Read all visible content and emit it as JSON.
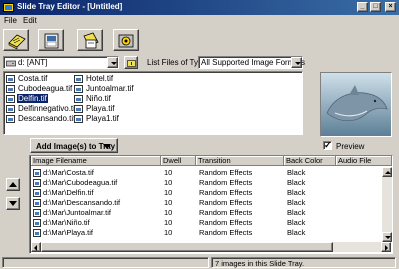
{
  "window": {
    "title": "Slide Tray Editor - [Untitled]"
  },
  "menu": {
    "items": [
      {
        "label": "File"
      },
      {
        "label": "Edit"
      }
    ]
  },
  "toolbar": {
    "buttons": [
      {
        "icon": "new-tray-icon"
      },
      {
        "icon": "open-tray-icon"
      },
      {
        "icon": "save-tray-icon"
      },
      {
        "icon": "settings-icon"
      }
    ]
  },
  "browser": {
    "drive": "d: [ANT]",
    "filetype_label": "List Files of Type:",
    "filetype_value": "All Supported Image Formats",
    "files": [
      {
        "name": "Costa.tif",
        "selected": false
      },
      {
        "name": "Cubodeagua.tif",
        "selected": false
      },
      {
        "name": "Delfin.tif",
        "selected": true
      },
      {
        "name": "Delfinnegativo.tif",
        "selected": false
      },
      {
        "name": "Descansando.tif",
        "selected": false
      },
      {
        "name": "Hotel.tif",
        "selected": false
      },
      {
        "name": "Juntoalmar.tif",
        "selected": false
      },
      {
        "name": "Niño.tif",
        "selected": false
      },
      {
        "name": "Playa.tif",
        "selected": false
      },
      {
        "name": "Playa1.tif",
        "selected": false
      }
    ]
  },
  "preview": {
    "label": "Preview",
    "checked": true
  },
  "add_button": {
    "label": "Add Image(s) to Tray"
  },
  "tray": {
    "columns": [
      "Image Filename",
      "Dwell",
      "Transition",
      "Back Color",
      "Audio File"
    ],
    "rows": [
      {
        "file": "d:\\Mar\\Costa.tif",
        "dwell": "10",
        "transition": "Random Effects",
        "back": "Black",
        "audio": ""
      },
      {
        "file": "d:\\Mar\\Cubodeagua.tif",
        "dwell": "10",
        "transition": "Random Effects",
        "back": "Black",
        "audio": ""
      },
      {
        "file": "d:\\Mar\\Delfin.tif",
        "dwell": "10",
        "transition": "Random Effects",
        "back": "Black",
        "audio": ""
      },
      {
        "file": "d:\\Mar\\Descansando.tif",
        "dwell": "10",
        "transition": "Random Effects",
        "back": "Black",
        "audio": ""
      },
      {
        "file": "d:\\Mar\\Juntoalmar.tif",
        "dwell": "10",
        "transition": "Random Effects",
        "back": "Black",
        "audio": ""
      },
      {
        "file": "d:\\Mar\\Niño.tif",
        "dwell": "10",
        "transition": "Random Effects",
        "back": "Black",
        "audio": ""
      },
      {
        "file": "d:\\Mar\\Playa.tif",
        "dwell": "10",
        "transition": "Random Effects",
        "back": "Black",
        "audio": ""
      }
    ]
  },
  "status": {
    "text": "7 images in this Slide Tray."
  },
  "colors": {
    "titlebar": "#0a246a",
    "face": "#d4d0c8",
    "selection": "#0a246a"
  }
}
